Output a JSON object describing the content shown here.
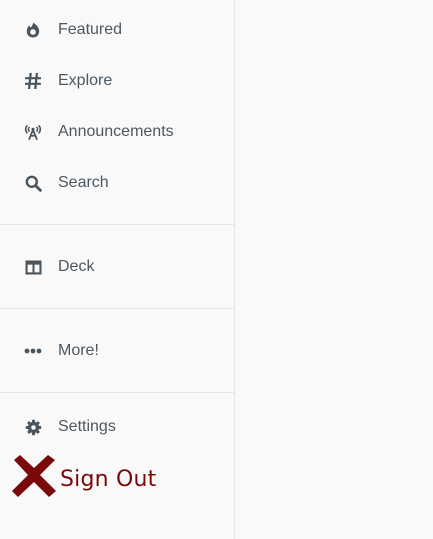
{
  "sidebar": {
    "items": [
      {
        "label": "Featured",
        "icon": "flame-icon"
      },
      {
        "label": "Explore",
        "icon": "hashtag-icon"
      },
      {
        "label": "Announcements",
        "icon": "broadcast-icon"
      },
      {
        "label": "Search",
        "icon": "search-icon"
      },
      {
        "label": "Deck",
        "icon": "columns-icon"
      },
      {
        "label": "More!",
        "icon": "more-icon"
      },
      {
        "label": "Settings",
        "icon": "gear-icon"
      }
    ],
    "sign_out": {
      "label": "Sign Out",
      "icon": "x-icon",
      "color": "#7a0a0a"
    }
  },
  "colors": {
    "background": "#f9f9f9",
    "text": "#4c5861",
    "icon": "#4a545c",
    "divider": "#e6e6e6"
  }
}
